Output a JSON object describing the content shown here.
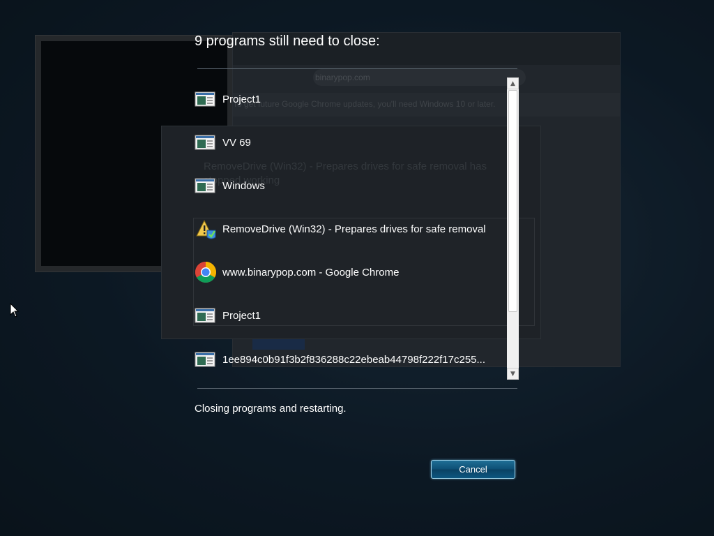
{
  "dialog": {
    "heading": "9 programs still need to close:",
    "status_text": "Closing programs and restarting.",
    "cancel_label": "Cancel"
  },
  "programs": [
    {
      "label": "Project1",
      "icon": "app-window-icon"
    },
    {
      "label": "VV 69",
      "icon": "app-window-icon"
    },
    {
      "label": "Windows",
      "icon": "app-window-icon"
    },
    {
      "label": "RemoveDrive (Win32) - Prepares drives for safe removal",
      "icon": "warning-shield-icon"
    },
    {
      "label": "www.binarypop.com - Google Chrome",
      "icon": "chrome-icon"
    },
    {
      "label": "Project1",
      "icon": "app-window-icon"
    },
    {
      "label": "1ee894c0b91f3b2f836288c22ebeab44798f222f17c255...",
      "icon": "app-window-icon"
    }
  ],
  "background": {
    "chrome_address": "binarypop.com",
    "chrome_info": "To get future Google Chrome updates, you'll need Windows 10 or later.",
    "error_title": "RemoveDrive (Win32) - Prepares drives for safe removal has stopped working"
  },
  "colors": {
    "accent": "#0d4f75",
    "button_border": "#9fd3ea",
    "background": "#0f1d29"
  }
}
